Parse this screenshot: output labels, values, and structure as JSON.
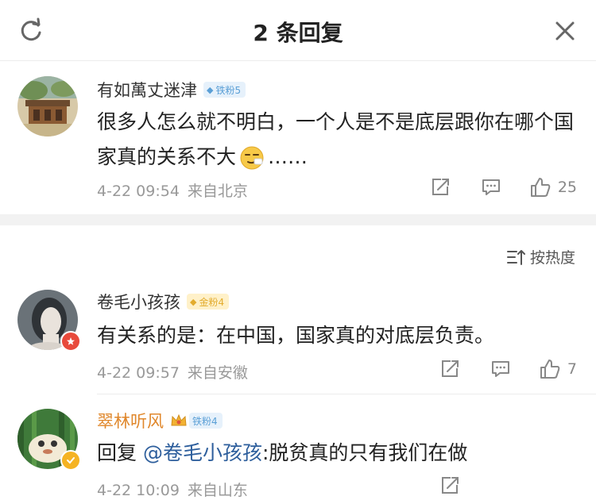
{
  "header": {
    "title": "2 条回复",
    "refresh_icon": "refresh-icon",
    "close_icon": "close-icon"
  },
  "root_comment": {
    "username": "有如萬丈迷津",
    "badge": "铁粉5",
    "text_before_emoji": "很多人怎么就不明白，一个人是不是底层跟你在哪个国家真的关系不大",
    "emoji": "smirk-emoji",
    "text_after_emoji": "……",
    "date": "4-22 09:54",
    "source": "来自北京",
    "likes": "25"
  },
  "sort": {
    "label": "按热度",
    "icon": "sort-icon"
  },
  "replies": [
    {
      "username": "卷毛小孩孩",
      "badge": "金粉4",
      "text": "有关系的是：在中国，国家真的对底层负责。",
      "date": "4-22 09:57",
      "source": "来自安徽",
      "likes": "7"
    },
    {
      "username": "翠林听风",
      "badge": "铁粉4",
      "reply_prefix": "回复 ",
      "mention": "@卷毛小孩孩",
      "text": ":脱贫真的只有我们在做",
      "date": "4-22 10:09",
      "source": "来自山东"
    }
  ],
  "colors": {
    "meta": "#999999",
    "iron_badge": "#5a9fd6",
    "gold_badge": "#e3ac2e",
    "mention": "#2d5e9c",
    "username_highlight": "#e0872b"
  }
}
